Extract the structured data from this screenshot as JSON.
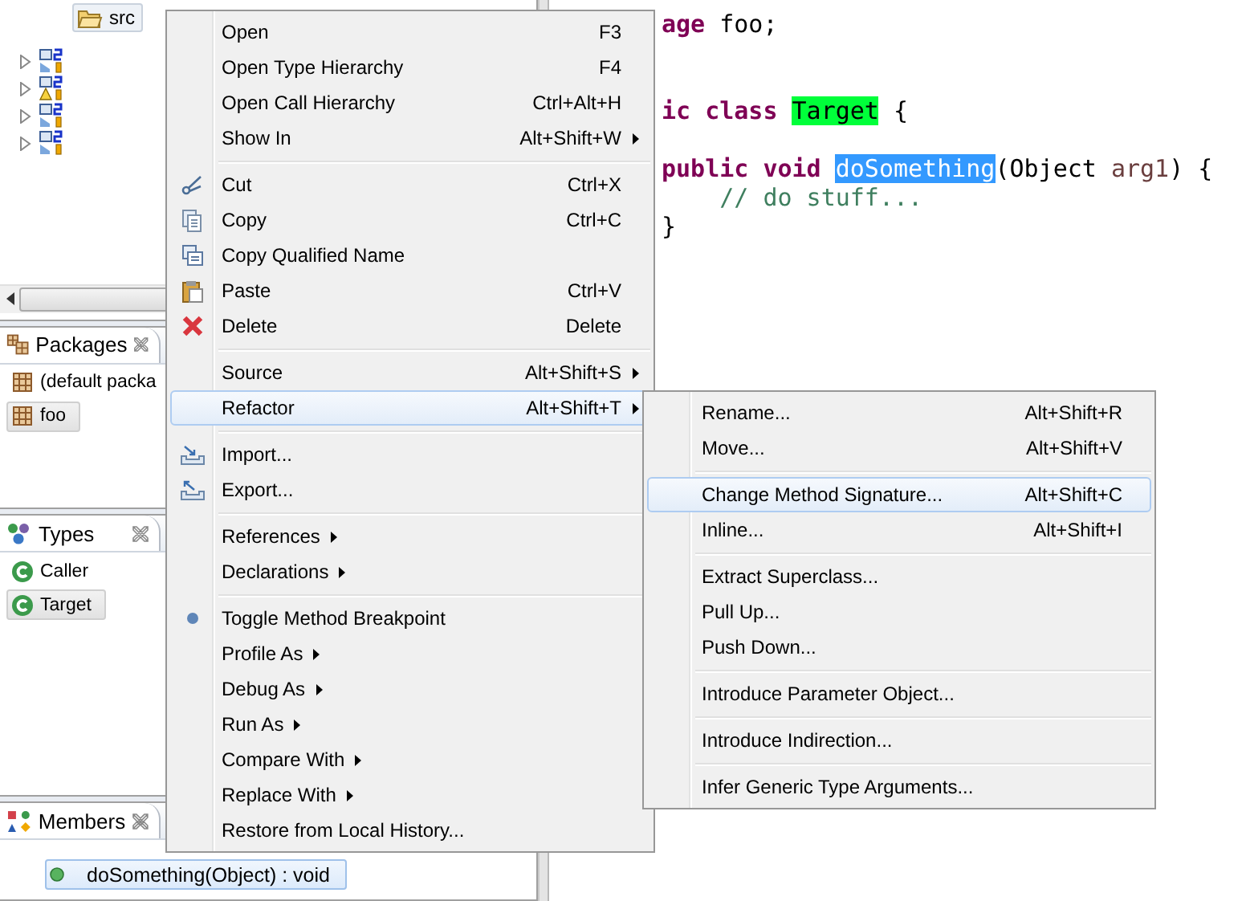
{
  "explorer": {
    "root_item": {
      "label": "src",
      "selected": true
    },
    "rows": [
      {
        "expanded": false,
        "warning": false
      },
      {
        "expanded": false,
        "warning": true
      },
      {
        "expanded": false,
        "warning": false
      },
      {
        "expanded": false,
        "warning": false
      }
    ]
  },
  "packages": {
    "title": "Packages",
    "items": [
      {
        "label": "(default packa",
        "selected": false
      },
      {
        "label": "foo",
        "selected": true
      }
    ]
  },
  "types": {
    "title": "Types",
    "items": [
      {
        "label": "Caller",
        "selected": false
      },
      {
        "label": "Target",
        "selected": true
      }
    ]
  },
  "members": {
    "title": "Members",
    "items": [
      {
        "label": "doSomething(Object) : void",
        "selected": true
      }
    ]
  },
  "editor": {
    "lines": [
      {
        "kind": "code",
        "tokens": [
          {
            "kind": "keyword",
            "text": "age"
          },
          {
            "kind": "plain",
            "text": " foo;"
          }
        ]
      },
      {
        "kind": "blank"
      },
      {
        "kind": "blank"
      },
      {
        "kind": "code",
        "tokens": [
          {
            "kind": "keyword",
            "text": "ic class "
          },
          {
            "kind": "type_mark",
            "text": "Target"
          },
          {
            "kind": "plain",
            "text": " {"
          }
        ]
      },
      {
        "kind": "blank"
      },
      {
        "kind": "code",
        "tokens": [
          {
            "kind": "keyword",
            "text": "public void "
          },
          {
            "kind": "occurrence",
            "text": "doSomething"
          },
          {
            "kind": "plain",
            "text": "(Object "
          },
          {
            "kind": "param",
            "text": "arg1"
          },
          {
            "kind": "plain",
            "text": ") {"
          }
        ]
      },
      {
        "kind": "code",
        "tokens": [
          {
            "kind": "comment",
            "text": "    // do stuff..."
          }
        ]
      },
      {
        "kind": "code",
        "tokens": [
          {
            "kind": "plain",
            "text": "}"
          }
        ]
      }
    ]
  },
  "context_menu": {
    "groups": [
      [
        {
          "label": "Open",
          "shortcut": "F3",
          "submenu": false,
          "selected": false
        },
        {
          "label": "Open Type Hierarchy",
          "shortcut": "F4",
          "submenu": false,
          "selected": false
        },
        {
          "label": "Open Call Hierarchy",
          "shortcut": "Ctrl+Alt+H",
          "submenu": false,
          "selected": false
        },
        {
          "label": "Show In",
          "shortcut": "Alt+Shift+W",
          "submenu": true,
          "selected": false
        }
      ],
      [
        {
          "label": "Cut",
          "shortcut": "Ctrl+X",
          "submenu": false,
          "selected": false
        },
        {
          "label": "Copy",
          "shortcut": "Ctrl+C",
          "submenu": false,
          "selected": false
        },
        {
          "label": "Copy Qualified Name",
          "submenu": false,
          "selected": false
        },
        {
          "label": "Paste",
          "shortcut": "Ctrl+V",
          "submenu": false,
          "selected": false
        },
        {
          "label": "Delete",
          "shortcut": "Delete",
          "submenu": false,
          "selected": false
        }
      ],
      [
        {
          "label": "Source",
          "shortcut": "Alt+Shift+S",
          "submenu": true,
          "selected": false
        },
        {
          "label": "Refactor",
          "shortcut": "Alt+Shift+T",
          "submenu": true,
          "selected": true
        }
      ],
      [
        {
          "label": "Import...",
          "submenu": false,
          "selected": false
        },
        {
          "label": "Export...",
          "submenu": false,
          "selected": false
        }
      ],
      [
        {
          "label": "References",
          "submenu": true,
          "selected": false
        },
        {
          "label": "Declarations",
          "submenu": true,
          "selected": false
        }
      ],
      [
        {
          "label": "Toggle Method Breakpoint",
          "submenu": false,
          "selected": false
        },
        {
          "label": "Profile As",
          "submenu": true,
          "selected": false
        },
        {
          "label": "Debug As",
          "submenu": true,
          "selected": false
        },
        {
          "label": "Run As",
          "submenu": true,
          "selected": false
        },
        {
          "label": "Compare With",
          "submenu": true,
          "selected": false
        },
        {
          "label": "Replace With",
          "submenu": true,
          "selected": false
        },
        {
          "label": "Restore from Local History...",
          "submenu": false,
          "selected": false
        }
      ]
    ]
  },
  "refactor_menu": {
    "groups": [
      [
        {
          "label": "Rename...",
          "shortcut": "Alt+Shift+R",
          "selected": false
        },
        {
          "label": "Move...",
          "shortcut": "Alt+Shift+V",
          "selected": false
        }
      ],
      [
        {
          "label": "Change Method Signature...",
          "shortcut": "Alt+Shift+C",
          "selected": true
        },
        {
          "label": "Inline...",
          "shortcut": "Alt+Shift+I",
          "selected": false
        }
      ],
      [
        {
          "label": "Extract Superclass...",
          "selected": false
        },
        {
          "label": "Pull Up...",
          "selected": false
        },
        {
          "label": "Push Down...",
          "selected": false
        }
      ],
      [
        {
          "label": "Introduce Parameter Object...",
          "selected": false
        }
      ],
      [
        {
          "label": "Introduce Indirection...",
          "selected": false
        }
      ],
      [
        {
          "label": "Infer Generic Type Arguments...",
          "selected": false
        }
      ]
    ]
  }
}
